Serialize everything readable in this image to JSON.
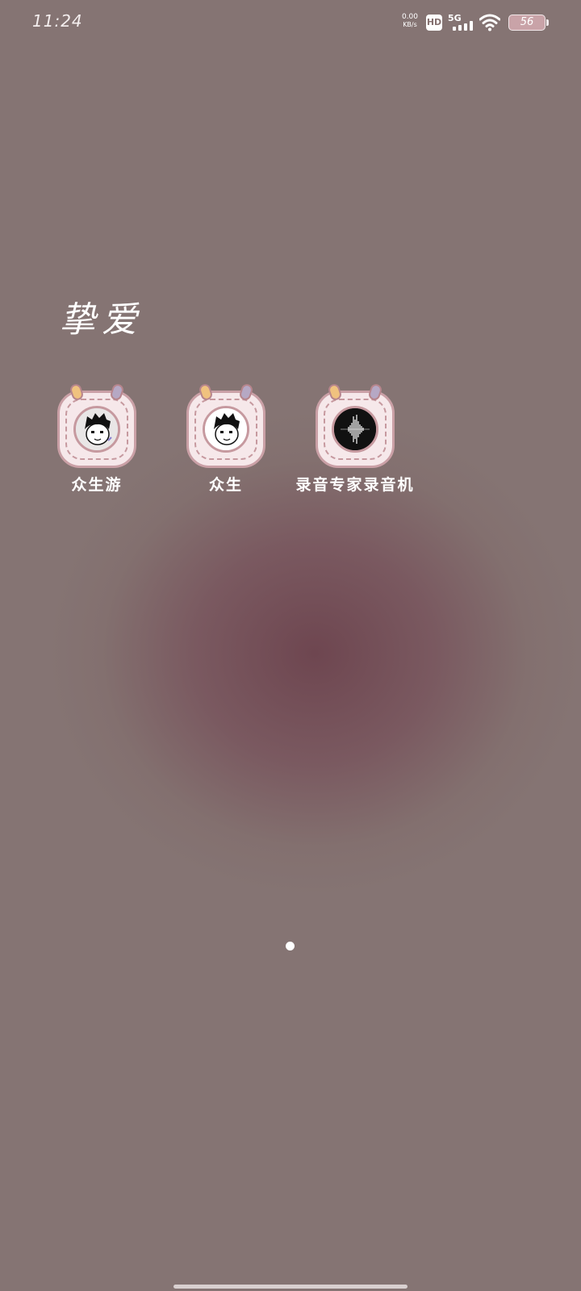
{
  "status_bar": {
    "time": "11:24",
    "net_speed_value": "0.00",
    "net_speed_unit": "KB/s",
    "hd_label": "HD",
    "network_type": "5G",
    "battery_level": "56",
    "icons": [
      "hd-icon",
      "cellular-signal-icon",
      "wifi-icon",
      "battery-icon"
    ]
  },
  "folder": {
    "title": "挚爱",
    "apps": [
      {
        "label": "众生游",
        "icon": "avatar-boy-icon"
      },
      {
        "label": "众生",
        "icon": "avatar-boy-icon"
      },
      {
        "label": "录音专家录音机",
        "icon": "sound-wave-icon"
      }
    ]
  },
  "pager": {
    "pages": 1,
    "current": 1
  },
  "colors": {
    "background": "#857473",
    "background_center": "#6e4650",
    "tile": "#f6e8ea",
    "tile_border": "#caa0a6",
    "battery_fill": "#c9a3a8"
  }
}
